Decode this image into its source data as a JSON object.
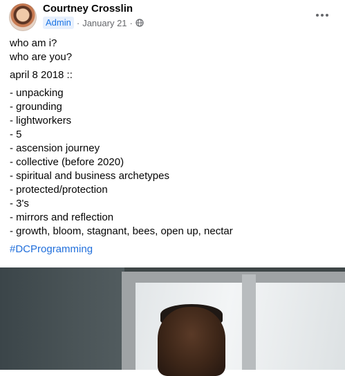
{
  "post": {
    "author": "Courtney Crosslin",
    "badge": "Admin",
    "separator": "·",
    "date": "January 21",
    "separator2": "·",
    "audience_icon": "globe-icon",
    "more_icon": "more-horizontal-icon",
    "text_lines": [
      "who am i?",
      "who are you?",
      "april 8 2018 ::",
      "- unpacking",
      "- grounding",
      "- lightworkers",
      "- 5",
      "- ascension journey",
      "- collective (before 2020)",
      "- spiritual and business archetypes",
      "- protected/protection",
      "- 3's",
      "- mirrors and reflection",
      "- growth, bloom, stagnant, bees, open up, nectar"
    ],
    "hashtag": "#DCProgramming"
  },
  "colors": {
    "link": "#216fdb",
    "badge_bg": "#e7f0fd",
    "badge_text": "#1b74e4",
    "secondary_text": "#65676b"
  }
}
